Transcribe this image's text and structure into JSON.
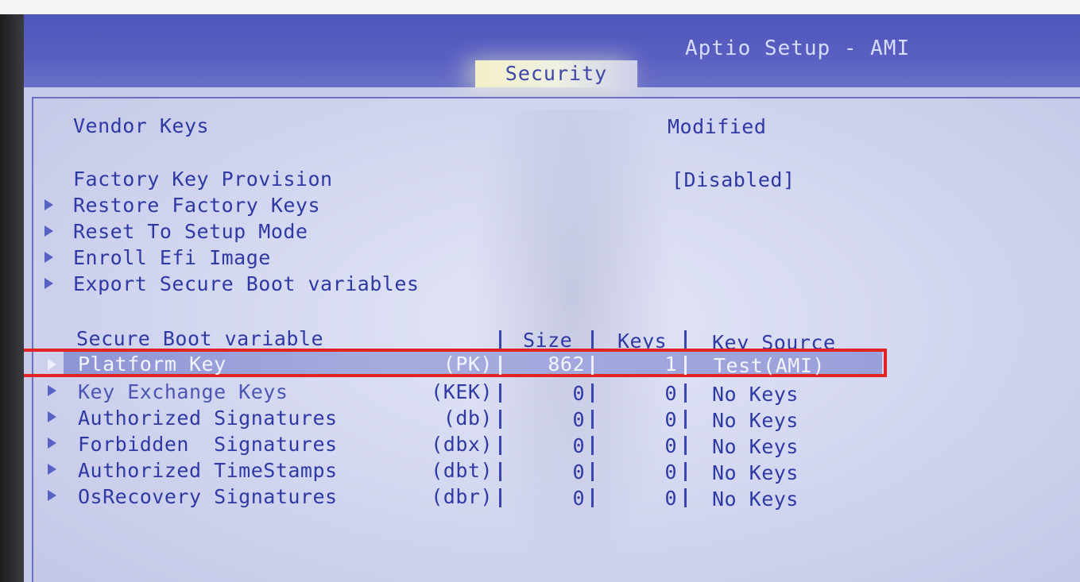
{
  "app_title": "Aptio Setup - AMI",
  "active_tab": "Security",
  "vendor_keys": {
    "label": "Vendor Keys",
    "value": "Modified"
  },
  "factory_key_provision": {
    "label": "Factory Key Provision",
    "value": "[Disabled]"
  },
  "submenus": [
    "Restore Factory Keys",
    "Reset To Setup Mode",
    "Enroll Efi Image",
    "Export Secure Boot variables"
  ],
  "table": {
    "headers": [
      "Secure Boot variable",
      "Size",
      "Keys",
      "Key Source"
    ],
    "rows": [
      {
        "name": "Platform Key",
        "abbr": "(PK)",
        "size": "862",
        "keys": "1",
        "source": "Test(AMI)",
        "selected": true
      },
      {
        "name": "Key Exchange Keys",
        "abbr": "(KEK)",
        "size": "0",
        "keys": "0",
        "source": "No Keys"
      },
      {
        "name": "Authorized Signatures",
        "abbr": "(db)",
        "size": "0",
        "keys": "0",
        "source": "No Keys"
      },
      {
        "name": "Forbidden  Signatures",
        "abbr": "(dbx)",
        "size": "0",
        "keys": "0",
        "source": "No Keys"
      },
      {
        "name": "Authorized TimeStamps",
        "abbr": "(dbt)",
        "size": "0",
        "keys": "0",
        "source": "No Keys"
      },
      {
        "name": "OsRecovery Signatures",
        "abbr": "(dbr)",
        "size": "0",
        "keys": "0",
        "source": "No Keys"
      }
    ]
  },
  "colors": {
    "header_bg": "#5a60c2",
    "panel_bg": "#d6d9f0",
    "text": "#2e39a4",
    "highlight_outline": "#e32222"
  }
}
